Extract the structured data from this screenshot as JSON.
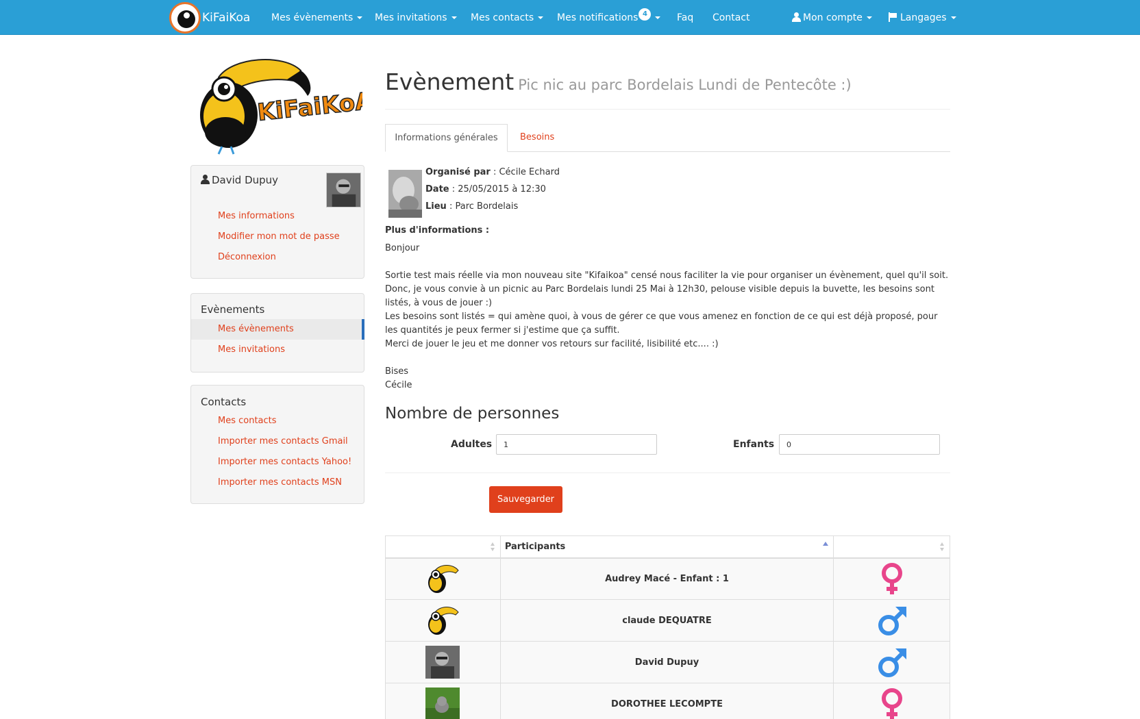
{
  "nav": {
    "brand": "KiFaiKoa",
    "items": [
      {
        "label": "Mes évènements"
      },
      {
        "label": "Mes invitations"
      },
      {
        "label": "Mes contacts"
      },
      {
        "label": "Mes notifications",
        "badge": "4"
      },
      {
        "label": "Faq"
      },
      {
        "label": "Contact"
      }
    ],
    "account": "Mon compte",
    "languages": "Langages"
  },
  "sidebar": {
    "user": {
      "name": "David Dupuy",
      "links": [
        "Mes informations",
        "Modifier mon mot de passe",
        "Déconnexion"
      ]
    },
    "events": {
      "title": "Evènements",
      "links": [
        "Mes évènements",
        "Mes invitations"
      ],
      "active": "Mes évènements"
    },
    "contacts": {
      "title": "Contacts",
      "links": [
        "Mes contacts",
        "Importer mes contacts Gmail",
        "Importer mes contacts Yahoo!",
        "Importer mes contacts MSN"
      ]
    }
  },
  "event": {
    "title": "Evènement",
    "subtitle": "Pic nic au parc Bordelais Lundi de Pentecôte :)",
    "tabs": [
      "Informations générales",
      "Besoins"
    ],
    "organizer_label": "Organisé par",
    "organizer": "Cécile Echard",
    "date_label": "Date",
    "date": "25/05/2015 à 12:30",
    "place_label": "Lieu",
    "place": "Parc Bordelais",
    "more_label": "Plus d'informations :",
    "description": "Bonjour\n\nSortie test mais réelle via mon nouveau site \"Kifaikoa\" censé nous faciliter la vie pour organiser un évènement, quel qu'il soit.\nDonc, je vous convie à un picnic au Parc Bordelais lundi 25 Mai à 12h30, pelouse visible depuis la buvette, les besoins sont listés, à vous de jouer :)\nLes besoins sont listés = qui amène quoi, à vous de gérer ce que vous amenez en fonction de ce qui est déjà proposé, pour les quantités je peux fermer si j'estime que ça suffit.\nMerci de jouer le jeu et me donner vos retours sur facilité, lisibilité etc.... :)\n\nBises\nCécile"
  },
  "people": {
    "title": "Nombre de personnes",
    "adults_label": "Adultes",
    "adults_value": "1",
    "children_label": "Enfants",
    "children_value": "0",
    "save_label": "Sauvegarder"
  },
  "participants": {
    "header": "Participants",
    "rows": [
      {
        "name": "Audrey Macé - Enfant : 1",
        "avatar": "toucan-icon",
        "gender": "female"
      },
      {
        "name": "claude DEQUATRE",
        "avatar": "toucan-icon",
        "gender": "male"
      },
      {
        "name": "David Dupuy",
        "avatar": "photo",
        "gender": "male"
      },
      {
        "name": "DOROTHEE LECOMPTE",
        "avatar": "kitten-photo",
        "gender": "female"
      }
    ]
  },
  "colors": {
    "navbar": "#2a9fd6",
    "link": "#e0401c",
    "active_marker": "#2a6ebb",
    "female": "#e8458b",
    "male": "#3a8ee6"
  }
}
